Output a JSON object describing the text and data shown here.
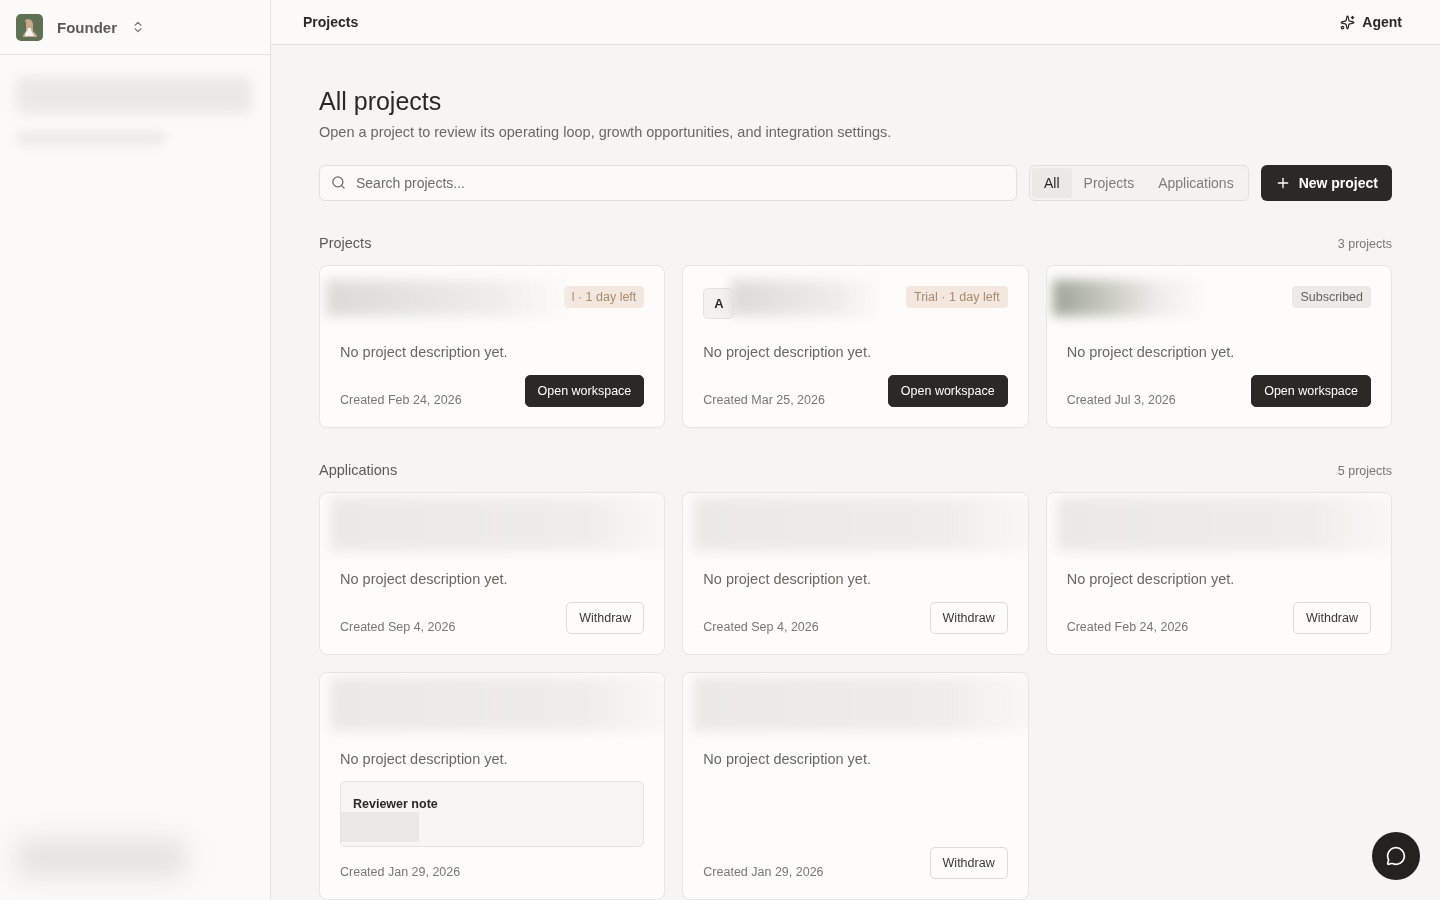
{
  "workspace": {
    "name": "Founder"
  },
  "breadcrumb": "Projects",
  "agent_button": "Agent",
  "page": {
    "title": "All projects",
    "subtitle": "Open a project to review its operating loop, growth opportunities, and integration settings."
  },
  "search": {
    "placeholder": "Search projects..."
  },
  "filters": [
    {
      "label": "All",
      "selected": true
    },
    {
      "label": "Projects",
      "selected": false
    },
    {
      "label": "Applications",
      "selected": false
    }
  ],
  "new_button": "New project",
  "sections": [
    {
      "title": "Projects",
      "count": "3 projects",
      "cards": [
        {
          "badge": {
            "text": "l · 1 day left",
            "kind": "trial"
          },
          "description": "No project description yet.",
          "created": "Created Feb 24, 2026",
          "action": {
            "kind": "primary",
            "label": "Open workspace"
          }
        },
        {
          "avatar": "A",
          "badge": {
            "text": "Trial · 1 day left",
            "kind": "trial"
          },
          "description": "No project description yet.",
          "created": "Created Mar 25, 2026",
          "action": {
            "kind": "primary",
            "label": "Open workspace"
          }
        },
        {
          "badge": {
            "text": "Subscribed",
            "kind": "subscribed"
          },
          "description": "No project description yet.",
          "created": "Created Jul 3, 2026",
          "action": {
            "kind": "primary",
            "label": "Open workspace"
          }
        }
      ]
    },
    {
      "title": "Applications",
      "count": "5 projects",
      "cards": [
        {
          "description": "No project description yet.",
          "created": "Created Sep 4, 2026",
          "action": {
            "kind": "secondary",
            "label": "Withdraw"
          }
        },
        {
          "description": "No project description yet.",
          "created": "Created Sep 4, 2026",
          "action": {
            "kind": "secondary",
            "label": "Withdraw"
          }
        },
        {
          "description": "No project description yet.",
          "created": "Created Feb 24, 2026",
          "action": {
            "kind": "secondary",
            "label": "Withdraw"
          }
        },
        {
          "description": "No project description yet.",
          "created": "Created Jan 29, 2026",
          "note": {
            "title": "Reviewer note"
          }
        },
        {
          "description": "No project description yet.",
          "created": "Created Jan 29, 2026",
          "action": {
            "kind": "secondary",
            "label": "Withdraw"
          }
        }
      ]
    }
  ]
}
